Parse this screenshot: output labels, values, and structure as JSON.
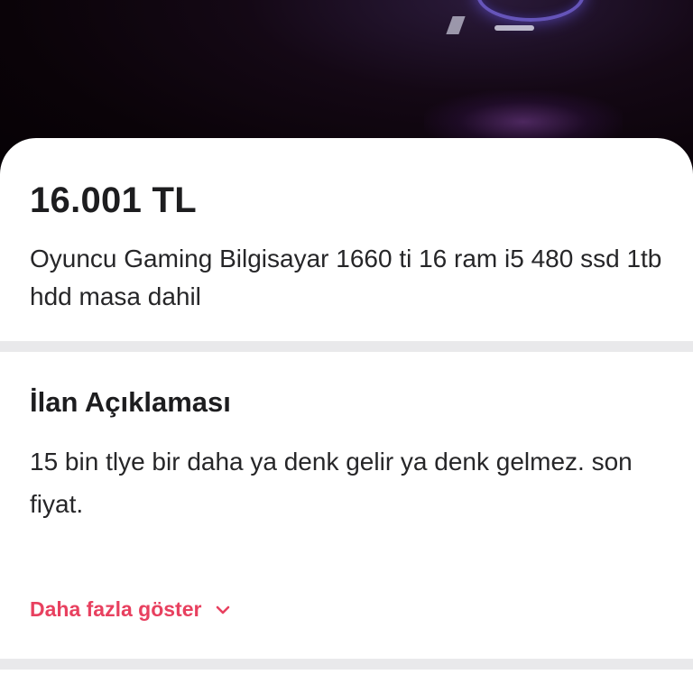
{
  "listing": {
    "price": "16.001 TL",
    "title": "Oyuncu Gaming Bilgisayar 1660 ti 16 ram i5 480 ssd 1tb hdd masa dahil"
  },
  "description": {
    "heading": "İlan Açıklaması",
    "text": "15 bin tlye bir daha ya denk gelir ya denk gelmez. son fiyat.",
    "more_label": "Daha fazla göster",
    "more_icon": "chevron-down-icon"
  },
  "colors": {
    "accent": "#e8405f",
    "text": "#262628",
    "divider": "#e9e9eb"
  }
}
